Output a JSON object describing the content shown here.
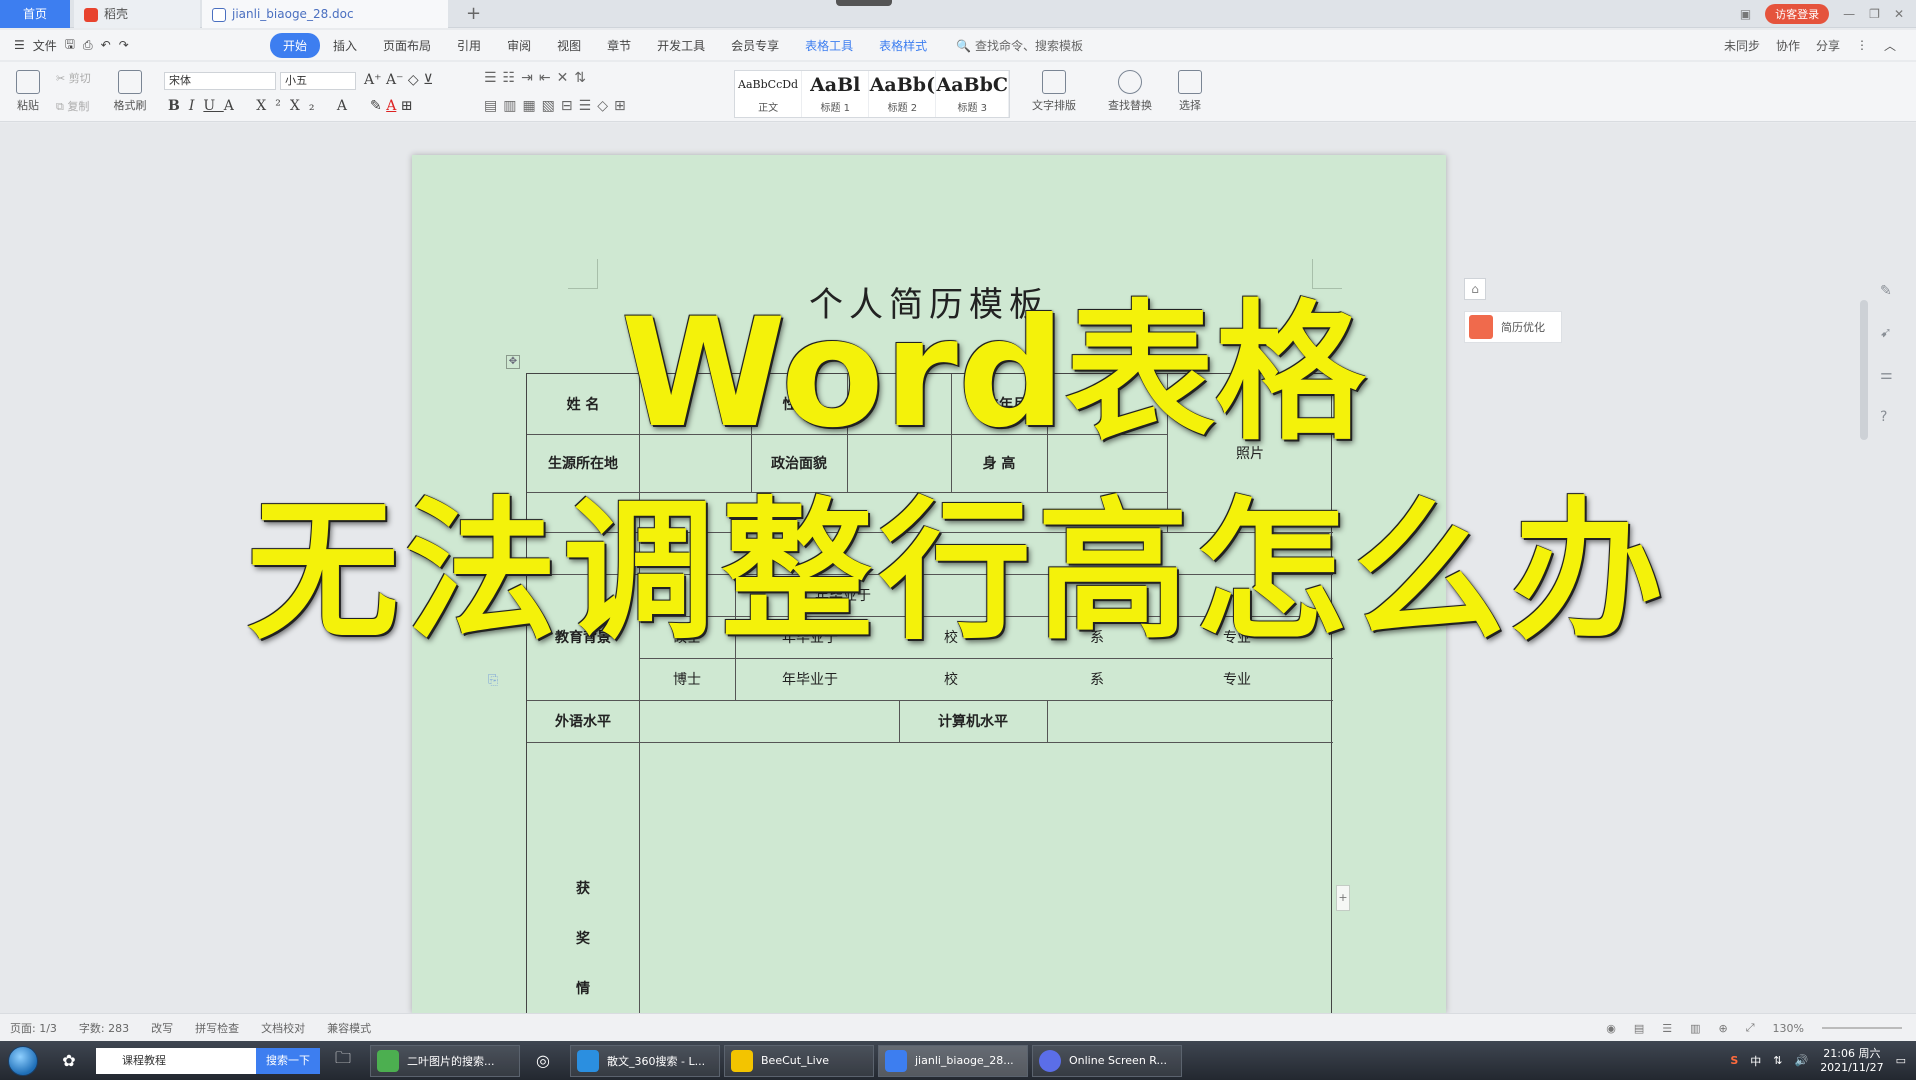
{
  "tabs": {
    "home": "首页",
    "doc1": "稻壳",
    "doc2": "jianli_biaoge_28.doc"
  },
  "titlebar": {
    "login": "访客登录"
  },
  "menu": {
    "file": "文件",
    "items": [
      "开始",
      "插入",
      "页面布局",
      "引用",
      "审阅",
      "视图",
      "章节",
      "开发工具",
      "会员专享",
      "表格工具",
      "表格样式"
    ],
    "search": "查找命令、搜索模板",
    "right": [
      "未同步",
      "协作",
      "分享"
    ]
  },
  "ribbon": {
    "paste": "粘贴",
    "cut": "剪切",
    "copy": "复制",
    "format_painter": "格式刷",
    "font_name": "宋体",
    "font_size": "小五",
    "styles": [
      {
        "preview": "AaBbCcDd",
        "name": "正文"
      },
      {
        "preview": "AaBl",
        "name": "标题 1"
      },
      {
        "preview": "AaBb(",
        "name": "标题 2"
      },
      {
        "preview": "AaBbC",
        "name": "标题 3"
      }
    ],
    "text_layout": "文字排版",
    "find_replace": "查找替换",
    "select": "选择"
  },
  "document": {
    "title": "个人简历模板",
    "cells": {
      "name": "姓  名",
      "gender": "性  别",
      "birth": "出生年月",
      "photo": "照片",
      "hometown": "生源所在地",
      "politics": "政治面貌",
      "height": "身  高",
      "education_bg": "教育背景",
      "master": "硕士",
      "phd": "博士",
      "grad1": "年毕业于",
      "grad2": "年毕业于",
      "grad3": "年毕业于",
      "school": "校",
      "school2": "校",
      "school3": "校",
      "dept": "系",
      "dept2": "系",
      "major": "专业",
      "major2": "专业",
      "language": "外语水平",
      "computer": "计算机水平",
      "awards": [
        "获",
        "奖",
        "情"
      ]
    }
  },
  "overlay": {
    "line1": "Word表格",
    "line2": "无法调整行高怎么办"
  },
  "side": {
    "resume_optimize": "简历优化"
  },
  "status": {
    "page": "页面: 1/3",
    "words": "字数: 283",
    "items": [
      "改写",
      "拼写检查",
      "文档校对",
      "兼容模式"
    ],
    "zoom": "130%"
  },
  "taskbar": {
    "search_text": "课程教程",
    "search_btn": "搜索一下",
    "tasks": [
      "二叶图片的搜索...",
      "散文_360搜索 - L...",
      "BeeCut_Live",
      "jianli_biaoge_28...",
      "Online Screen R..."
    ],
    "time": "21:06 周六",
    "date": "2021/11/27",
    "ime": "中"
  },
  "colors": {
    "accent": "#3d7ef0",
    "page_bg": "#cfe8d2",
    "overlay_text": "#f4f20a"
  }
}
